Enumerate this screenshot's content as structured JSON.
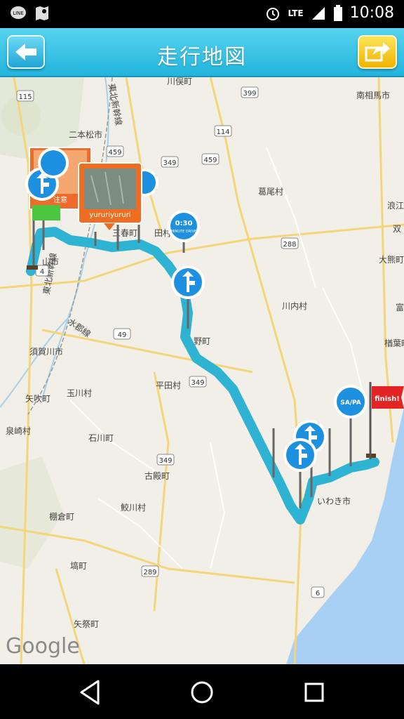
{
  "status_bar": {
    "time": "10:08",
    "network": "LTE",
    "left_icons": [
      "line-icon",
      "map-pin-icon"
    ]
  },
  "app_bar": {
    "title": "走行地図",
    "back_icon": "arrow-left-icon",
    "share_icon": "share-arrow-icon"
  },
  "map": {
    "labels": {
      "nihonmatsu": "二本松市",
      "kawamata": "川俣町",
      "minamisoma": "南相馬市",
      "katsurao": "葛尾村",
      "kawauchi": "川内村",
      "sukagawa": "須賀川市",
      "yabuki": "矢吹町",
      "tamakawa": "玉川村",
      "hirata": "平田村",
      "izumizaki": "泉崎村",
      "ishikawa": "石川町",
      "furudono": "古殿町",
      "samegawa": "鮫川村",
      "tanagura": "棚倉町",
      "hanawa": "塙町",
      "yamatsuri": "矢祭町",
      "iwaki": "いわき市",
      "naraha": "楢葉町",
      "namie": "浪江",
      "futaba": "双",
      "okuma": "大熊町",
      "tomioka": "富",
      "miharu": "三春町",
      "tamura": "田村",
      "ono": "野町",
      "koriyama": "山市",
      "suigun": "水郡線",
      "tohoku_shinkansen_n": "東北新幹線",
      "tohoku_shinkansen_s": "東北新幹線",
      "caution": "注意"
    },
    "highways": [
      "115",
      "4",
      "459",
      "349",
      "114",
      "399",
      "288",
      "49",
      "349",
      "349",
      "289",
      "6",
      "459"
    ],
    "photo_caption": "yururiyururi",
    "drive_badge_time": "0:30",
    "drive_badge_label": "MINUTE DRIVE",
    "sapa_label": "SA/PA",
    "finish_label": "finish!",
    "attribution": "Google"
  },
  "colors": {
    "route": "#2fb3d3",
    "appbar": "#2bbbe2",
    "marker": "#1e90e0",
    "finish": "#e32424"
  },
  "nav_bar": {
    "icons": [
      "back-triangle-icon",
      "home-circle-icon",
      "recents-square-icon"
    ]
  }
}
